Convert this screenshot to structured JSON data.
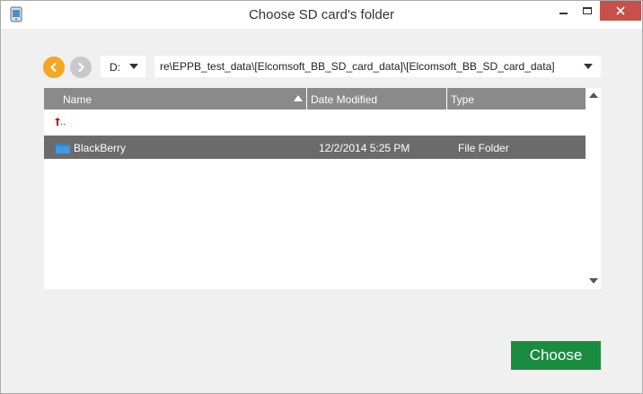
{
  "window": {
    "title": "Choose SD card's folder",
    "app_icon": "phone-icon",
    "controls": {
      "minimize_icon": "minimize-icon",
      "maximize_icon": "maximize-icon",
      "close_icon": "close-icon"
    }
  },
  "toolbar": {
    "back_icon": "chevron-left-icon",
    "forward_icon": "chevron-right-icon",
    "drive": "D:",
    "path": "re\\EPPB_test_data\\[Elcomsoft_BB_SD_card_data]\\[Elcomsoft_BB_SD_card_data]"
  },
  "file_list": {
    "columns": [
      "Name",
      "Date Modified",
      "Type"
    ],
    "sorted_column": "Name",
    "up_label": "..",
    "rows": [
      {
        "name": "BlackBerry",
        "date": "12/2/2014 5:25 PM",
        "type": "File Folder",
        "icon": "folder-icon",
        "selected": true
      }
    ]
  },
  "actions": {
    "choose_label": "Choose"
  },
  "colors": {
    "accent_orange": "#f5a623",
    "choose_green": "#1a8c3f",
    "header_gray": "#8a8a8a",
    "selected_row": "#6b6b6b",
    "close_red": "#c7504a"
  }
}
